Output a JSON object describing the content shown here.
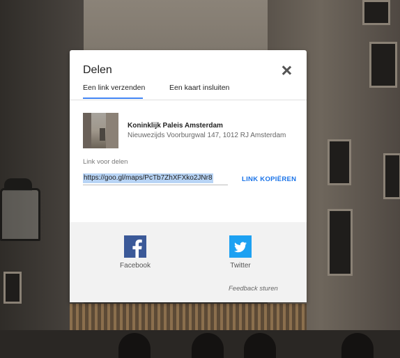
{
  "dialog": {
    "title": "Delen",
    "tabs": [
      "Een link verzenden",
      "Een kaart insluiten"
    ],
    "place": {
      "name": "Koninklijk Paleis Amsterdam",
      "address": "Nieuwezijds Voorburgwal 147, 1012 RJ Amsterdam"
    },
    "link_label": "Link voor delen",
    "link_value": "https://goo.gl/maps/PcTb7ZhXFXko2JNr8",
    "copy_button": "LINK KOPIËREN",
    "share": [
      {
        "label": "Facebook",
        "icon": "facebook-icon",
        "color": "#3b5998"
      },
      {
        "label": "Twitter",
        "icon": "twitter-icon",
        "color": "#1da1f2"
      }
    ],
    "feedback": "Feedback sturen"
  },
  "colors": {
    "accent": "#4285f4",
    "link_button": "#1a73e8",
    "selection": "#b8d4f5"
  }
}
